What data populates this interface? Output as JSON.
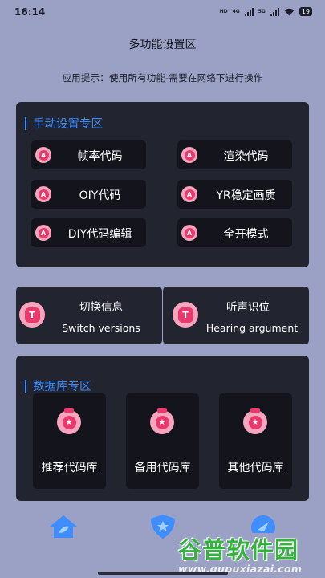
{
  "status_bar": {
    "time": "16:14",
    "hd_tag": "HD",
    "net1": "4G",
    "net2": "5G",
    "battery": "19"
  },
  "header": {
    "title": "多功能设置区",
    "tip": "应用提示：使用所有功能-需要在网络下进行操作"
  },
  "manual_section": {
    "title": "手动设置专区",
    "badge_letter": "A",
    "buttons": [
      {
        "label": "帧率代码"
      },
      {
        "label": "渲染代码"
      },
      {
        "label": "OIY代码"
      },
      {
        "label": "YR稳定画质"
      },
      {
        "label": "DIY代码编辑"
      },
      {
        "label": "全开模式"
      }
    ]
  },
  "switch_cards": [
    {
      "icon_letter": "T",
      "title": "切换信息",
      "subtitle": "Switch versions"
    },
    {
      "icon_letter": "T",
      "title": "听声识位",
      "subtitle": "Hearing argument"
    }
  ],
  "database_section": {
    "title": "数据库专区",
    "star": "★",
    "items": [
      {
        "label": "推荐代码库"
      },
      {
        "label": "备用代码库"
      },
      {
        "label": "其他代码库"
      }
    ]
  },
  "bottom_nav": {
    "icons": [
      "home-icon",
      "shield-icon",
      "compass-icon"
    ]
  },
  "watermark": {
    "brand": "谷普软件园",
    "url": "www.gupuxiazai.com"
  },
  "colors": {
    "background": "#9ba1c4",
    "panel": "#22242f",
    "button": "#14151c",
    "accent_blue": "#3b8cff",
    "badge_pink": "#e8386c",
    "watermark_green": "#36b140"
  }
}
